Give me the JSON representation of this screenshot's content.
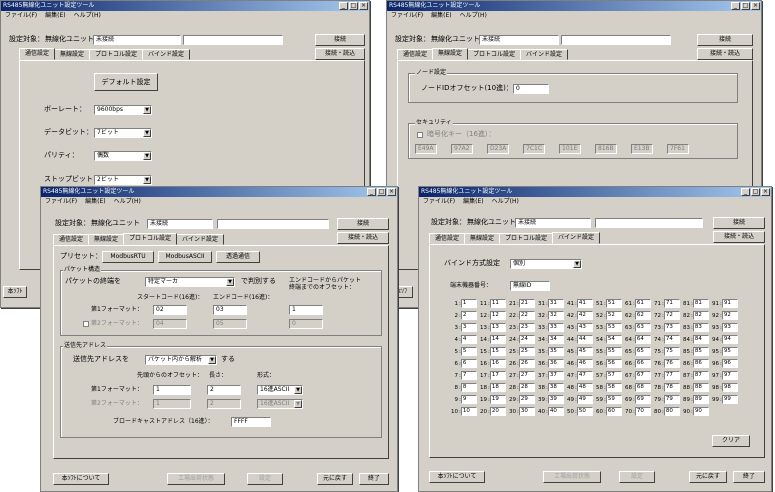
{
  "app_title": "RS485無線化ユニット設定ツール",
  "menu": [
    "ファイル(F)",
    "編集(E)",
    "ヘルプ(H)"
  ],
  "target_label": "設定対象：",
  "target_name": "無線化ユニット",
  "status_value": "未接続",
  "connect_label": "接続",
  "write_read_label": "接続・読込",
  "tabs": [
    "通信設定",
    "無線設定",
    "プロトコル設定",
    "バインド設定"
  ],
  "w1": {
    "default_btn": "デフォルト設定",
    "baud_label": "ボーレート：",
    "baud_value": "9600bps",
    "databit_label": "データビット：",
    "databit_value": "7ビット",
    "parity_label": "パリティ：",
    "parity_value": "偶数",
    "stopbit_label": "ストップビット：",
    "stopbit_value": "2ビット",
    "about_btn": "本ｿﾌﾄ"
  },
  "w2": {
    "node_group": "ノード設定",
    "node_label": "ノードIDオフセット(10進)：",
    "node_value": "0",
    "sec_group": "セキュリティ",
    "enc_label": "暗号化キー（16進）：",
    "keys": [
      "E49A",
      "97A2",
      "D23A",
      "7C1C",
      "101E",
      "816B",
      "E13B",
      "7F61"
    ],
    "about_btn": "本ｿﾌ"
  },
  "w3": {
    "preset_label": "プリセット：",
    "preset_rtu": "ModbusRTU",
    "preset_ascii": "ModbusASCII",
    "preset_transparent": "透過通信",
    "packet_group": "パケット構造",
    "packet_end_label": "パケットの終端を",
    "packet_end_value": "特定マーカ",
    "packet_end_suffix": "で判別する",
    "start_code_label": "スタートコード(16進)：",
    "end_code_label": "エンドコード(16進)：",
    "offset_label": "エンドコードからパケット\n終端までのオフセット：",
    "fmt1_label": "第1フォーマット：",
    "fmt1_start": "02",
    "fmt1_end": "03",
    "fmt1_offset": "1",
    "fmt2_label": "第2フォーマット：",
    "fmt2_start": "04",
    "fmt2_end": "05",
    "fmt2_offset": "0",
    "dest_group": "送信先アドレス",
    "dest_label": "送信先アドレスを",
    "dest_value": "パケット内から解析",
    "dest_suffix": "する",
    "head_offset_label": "先頭からのオフセット：",
    "length_label": "長さ：",
    "format_label": "形式：",
    "d1_label": "第1フォーマット：",
    "d1_offset": "1",
    "d1_len": "2",
    "d1_fmt": "16進ASCII",
    "d2_label": "第2フォーマット：",
    "d2_offset": "1",
    "d2_len": "2",
    "d2_fmt": "16進ASCII",
    "broadcast_label": "ブロードキャストアドレス（16進）：",
    "broadcast_value": "FFFF",
    "about_btn": "本ｿﾌﾄについて",
    "write_btn": "工場出荷状態",
    "set_btn": "設定",
    "restore_btn": "元に戻す",
    "exit_btn": "終了"
  },
  "w4": {
    "bind_method_label": "バインド方式設定",
    "bind_method_value": "個別",
    "terminal_label": "端末機器番号：",
    "terminal_value": "無線ID",
    "numbers": [
      1,
      11,
      21,
      31,
      41,
      51,
      61,
      71,
      81,
      91,
      2,
      12,
      22,
      32,
      42,
      52,
      62,
      72,
      82,
      92,
      3,
      13,
      23,
      33,
      43,
      53,
      63,
      73,
      83,
      93,
      4,
      14,
      24,
      34,
      44,
      54,
      64,
      74,
      84,
      94,
      5,
      15,
      25,
      35,
      45,
      55,
      65,
      75,
      85,
      95,
      6,
      16,
      26,
      36,
      46,
      56,
      66,
      76,
      86,
      96,
      7,
      17,
      27,
      37,
      47,
      57,
      67,
      77,
      87,
      97,
      8,
      18,
      28,
      38,
      48,
      58,
      68,
      78,
      88,
      98,
      9,
      19,
      29,
      39,
      49,
      59,
      69,
      79,
      89,
      99,
      10,
      20,
      30,
      40,
      50,
      60,
      70,
      80,
      90,
      ""
    ],
    "clear_btn": "クリア",
    "about_btn": "本ｿﾌﾄについて",
    "write_btn": "工場出荷状態",
    "set_btn": "設定",
    "restore_btn": "元に戻す",
    "exit_btn": "終了"
  }
}
